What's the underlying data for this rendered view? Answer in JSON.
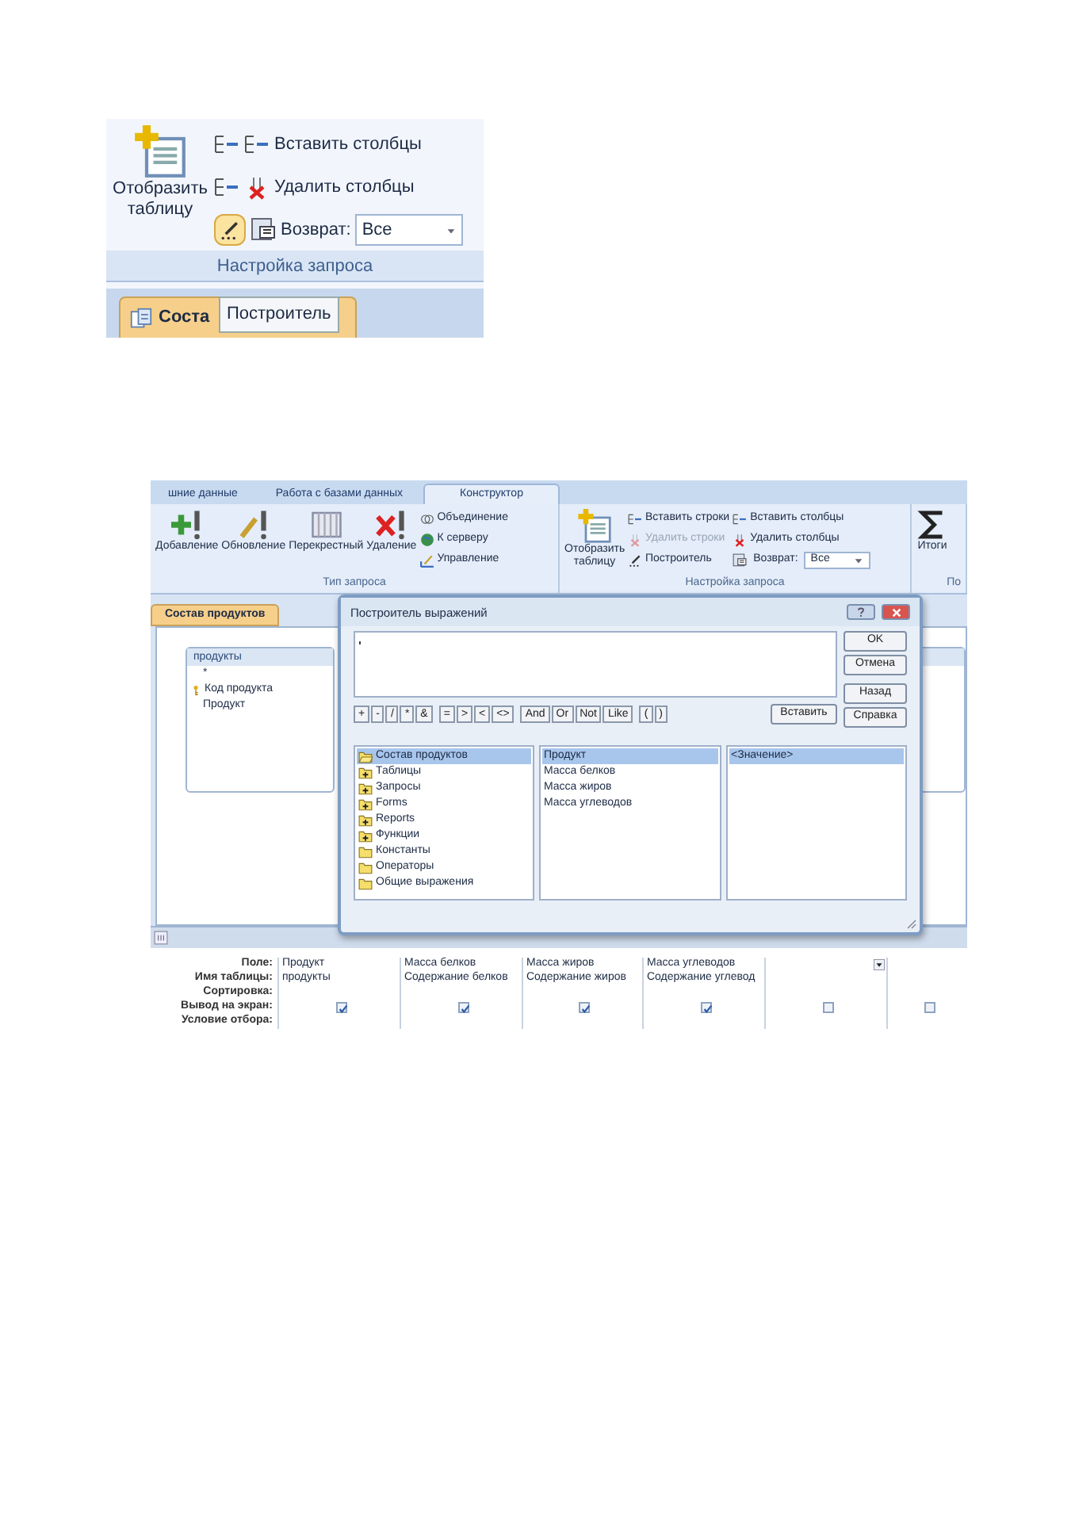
{
  "top_screenshot": {
    "show_table_button": {
      "label": "Отобразить таблицу"
    },
    "commands": [
      {
        "label": "Вставить столбцы",
        "kind": "insert"
      },
      {
        "label": "Удалить столбцы",
        "kind": "delete"
      }
    ],
    "builder_button": {
      "selected": true
    },
    "return": {
      "label": "Возврат:",
      "value": "Все"
    },
    "group_label": "Настройка запроса",
    "document_tab": {
      "label": "Соста"
    },
    "tooltip": "Построитель"
  },
  "bottom_screenshot": {
    "ribbon_tabs": [
      {
        "label": "шние данные",
        "selected": false
      },
      {
        "label": "Работа с базами данных",
        "selected": false
      },
      {
        "label": "Конструктор",
        "selected": true
      }
    ],
    "query_type_group": {
      "buttons": [
        {
          "label": "Добавление",
          "kind": "append"
        },
        {
          "label": "Обновление",
          "kind": "update"
        },
        {
          "label": "Перекрестный",
          "kind": "crosstab"
        },
        {
          "label": "Удаление",
          "kind": "delete"
        }
      ],
      "small_buttons": [
        {
          "label": "Объединение",
          "kind": "union"
        },
        {
          "label": "К серверу",
          "kind": "server"
        },
        {
          "label": "Управление",
          "kind": "manage"
        }
      ],
      "label": "Тип запроса"
    },
    "setup_group": {
      "show_table_button": {
        "label": "Отобразить таблицу"
      },
      "commands": [
        {
          "label": "Вставить строки",
          "kind": "insert",
          "disabled": false
        },
        {
          "label": "Удалить строки",
          "kind": "delete",
          "disabled": true
        },
        {
          "label": "Построитель",
          "kind": "builder",
          "disabled": false
        },
        {
          "label": "Вставить столбцы",
          "kind": "insert",
          "disabled": false
        },
        {
          "label": "Удалить столбцы",
          "kind": "delete",
          "disabled": false
        }
      ],
      "return": {
        "label": "Возврат:",
        "value": "Все"
      },
      "label": "Настройка запроса"
    },
    "totals_group": {
      "button": "Итоги",
      "label": "По"
    },
    "document_tab": "Состав продуктов",
    "table_box": {
      "title": "продукты",
      "fields": [
        {
          "name": "*",
          "primary_key": false
        },
        {
          "name": "Код продукта",
          "primary_key": true
        },
        {
          "name": "Продукт",
          "primary_key": false
        }
      ]
    },
    "dialog": {
      "title": "Построитель выражений",
      "side_buttons": [
        "OK",
        "Отмена",
        "Назад",
        "Справка"
      ],
      "operators": [
        "+",
        "-",
        "/",
        "*",
        "&",
        "=",
        ">",
        "<",
        "<>",
        "And",
        "Or",
        "Not",
        "Like",
        "(",
        ")"
      ],
      "paste_button": "Вставить",
      "tree": [
        {
          "label": "Состав продуктов",
          "kind": "open",
          "selected": true
        },
        {
          "label": "Таблицы",
          "kind": "plus",
          "selected": false
        },
        {
          "label": "Запросы",
          "kind": "plus",
          "selected": false
        },
        {
          "label": "Forms",
          "kind": "plus",
          "selected": false
        },
        {
          "label": "Reports",
          "kind": "plus",
          "selected": false
        },
        {
          "label": "Функции",
          "kind": "plus",
          "selected": false
        },
        {
          "label": "Константы",
          "kind": "plain",
          "selected": false
        },
        {
          "label": "Операторы",
          "kind": "plain",
          "selected": false
        },
        {
          "label": "Общие выражения",
          "kind": "plain",
          "selected": false
        }
      ],
      "fields_list": [
        {
          "label": "Продукт",
          "selected": true
        },
        {
          "label": "Масса белков",
          "selected": false
        },
        {
          "label": "Масса жиров",
          "selected": false
        },
        {
          "label": "Масса углеводов",
          "selected": false
        }
      ],
      "values_list": [
        {
          "label": "<Значение>",
          "selected": true
        }
      ]
    },
    "grid": {
      "row_labels": [
        "Поле:",
        "Имя таблицы:",
        "Сортировка:",
        "Вывод на экран:",
        "Условие отбора:"
      ],
      "columns": [
        {
          "field": "Продукт",
          "table": "продукты",
          "show": true
        },
        {
          "field": "Масса белков",
          "table": "Содержание белков",
          "show": true
        },
        {
          "field": "Масса жиров",
          "table": "Содержание жиров",
          "show": true
        },
        {
          "field": "Масса углеводов",
          "table": "Содержание углевод",
          "show": true
        },
        {
          "dropdown": true,
          "show": false
        },
        {
          "show": false
        }
      ]
    }
  }
}
